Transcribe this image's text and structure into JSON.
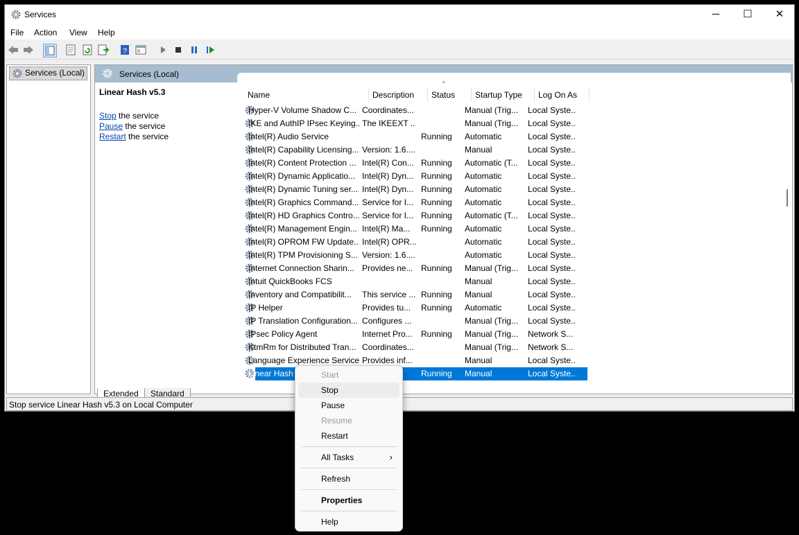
{
  "window": {
    "title": "Services",
    "minimize": "─",
    "maximize": "☐",
    "close": "✕"
  },
  "menu": [
    "File",
    "Action",
    "View",
    "Help"
  ],
  "toolbar_icons": [
    "back-icon",
    "forward-icon",
    "show-hide-tree-icon",
    "properties-icon",
    "refresh-icon",
    "export-list-icon",
    "help-icon",
    "console-icon",
    "play-icon",
    "stop-icon",
    "pause-icon",
    "resume-icon"
  ],
  "tree": {
    "root": "Services (Local)"
  },
  "pane": {
    "header": "Services (Local)",
    "selected_service": "Linear Hash v5.3",
    "actions": [
      {
        "link": "Stop",
        "rest": " the service"
      },
      {
        "link": "Pause",
        "rest": " the service"
      },
      {
        "link": "Restart",
        "rest": " the service"
      }
    ]
  },
  "columns": [
    "Name",
    "Description",
    "Status",
    "Startup Type",
    "Log On As"
  ],
  "rows": [
    {
      "name": "Hyper-V Volume Shadow C...",
      "desc": "Coordinates...",
      "status": "",
      "startup": "Manual (Trig...",
      "logon": "Local Syste..."
    },
    {
      "name": "IKE and AuthIP IPsec Keying...",
      "desc": "The IKEEXT ...",
      "status": "",
      "startup": "Manual (Trig...",
      "logon": "Local Syste..."
    },
    {
      "name": "Intel(R) Audio Service",
      "desc": "",
      "status": "Running",
      "startup": "Automatic",
      "logon": "Local Syste..."
    },
    {
      "name": "Intel(R) Capability Licensing...",
      "desc": "Version: 1.6....",
      "status": "",
      "startup": "Manual",
      "logon": "Local Syste..."
    },
    {
      "name": "Intel(R) Content Protection ...",
      "desc": "Intel(R) Con...",
      "status": "Running",
      "startup": "Automatic (T...",
      "logon": "Local Syste..."
    },
    {
      "name": "Intel(R) Dynamic Applicatio...",
      "desc": "Intel(R) Dyn...",
      "status": "Running",
      "startup": "Automatic",
      "logon": "Local Syste..."
    },
    {
      "name": "Intel(R) Dynamic Tuning ser...",
      "desc": "Intel(R) Dyn...",
      "status": "Running",
      "startup": "Automatic",
      "logon": "Local Syste..."
    },
    {
      "name": "Intel(R) Graphics Command...",
      "desc": "Service for I...",
      "status": "Running",
      "startup": "Automatic",
      "logon": "Local Syste..."
    },
    {
      "name": "Intel(R) HD Graphics Contro...",
      "desc": "Service for I...",
      "status": "Running",
      "startup": "Automatic (T...",
      "logon": "Local Syste..."
    },
    {
      "name": "Intel(R) Management Engin...",
      "desc": "Intel(R) Ma...",
      "status": "Running",
      "startup": "Automatic",
      "logon": "Local Syste..."
    },
    {
      "name": "Intel(R) OPROM FW Update...",
      "desc": "Intel(R) OPR...",
      "status": "",
      "startup": "Automatic",
      "logon": "Local Syste..."
    },
    {
      "name": "Intel(R) TPM Provisioning S...",
      "desc": "Version: 1.6....",
      "status": "",
      "startup": "Automatic",
      "logon": "Local Syste..."
    },
    {
      "name": "Internet Connection Sharin...",
      "desc": "Provides ne...",
      "status": "Running",
      "startup": "Manual (Trig...",
      "logon": "Local Syste..."
    },
    {
      "name": "Intuit QuickBooks FCS",
      "desc": "",
      "status": "",
      "startup": "Manual",
      "logon": "Local Syste..."
    },
    {
      "name": "Inventory and Compatibilit...",
      "desc": "This service ...",
      "status": "Running",
      "startup": "Manual",
      "logon": "Local Syste..."
    },
    {
      "name": "IP Helper",
      "desc": "Provides tu...",
      "status": "Running",
      "startup": "Automatic",
      "logon": "Local Syste..."
    },
    {
      "name": "IP Translation Configuration...",
      "desc": "Configures ...",
      "status": "",
      "startup": "Manual (Trig...",
      "logon": "Local Syste..."
    },
    {
      "name": "IPsec Policy Agent",
      "desc": "Internet Pro...",
      "status": "Running",
      "startup": "Manual (Trig...",
      "logon": "Network S..."
    },
    {
      "name": "KtmRm for Distributed Tran...",
      "desc": "Coordinates...",
      "status": "",
      "startup": "Manual (Trig...",
      "logon": "Network S..."
    },
    {
      "name": "Language Experience Service",
      "desc": "Provides inf...",
      "status": "",
      "startup": "Manual",
      "logon": "Local Syste..."
    },
    {
      "name": "Linear Hash v5.3",
      "desc": "",
      "status": "Running",
      "startup": "Manual",
      "logon": "Local Syste...",
      "selected": true
    }
  ],
  "tabs": [
    "Extended",
    "Standard"
  ],
  "status_bar": "Stop service Linear Hash v5.3 on Local Computer",
  "context_menu": {
    "items": [
      "Start",
      "Stop",
      "Pause",
      "Resume",
      "Restart",
      "All Tasks",
      "Refresh",
      "Properties",
      "Help"
    ],
    "disabled": [
      "Start",
      "Resume"
    ],
    "highlighted": "Stop",
    "bold": "Properties"
  },
  "colors": {
    "selection": "#0078d7",
    "pane_header": "#a6bcd1",
    "link": "#0645ad"
  }
}
